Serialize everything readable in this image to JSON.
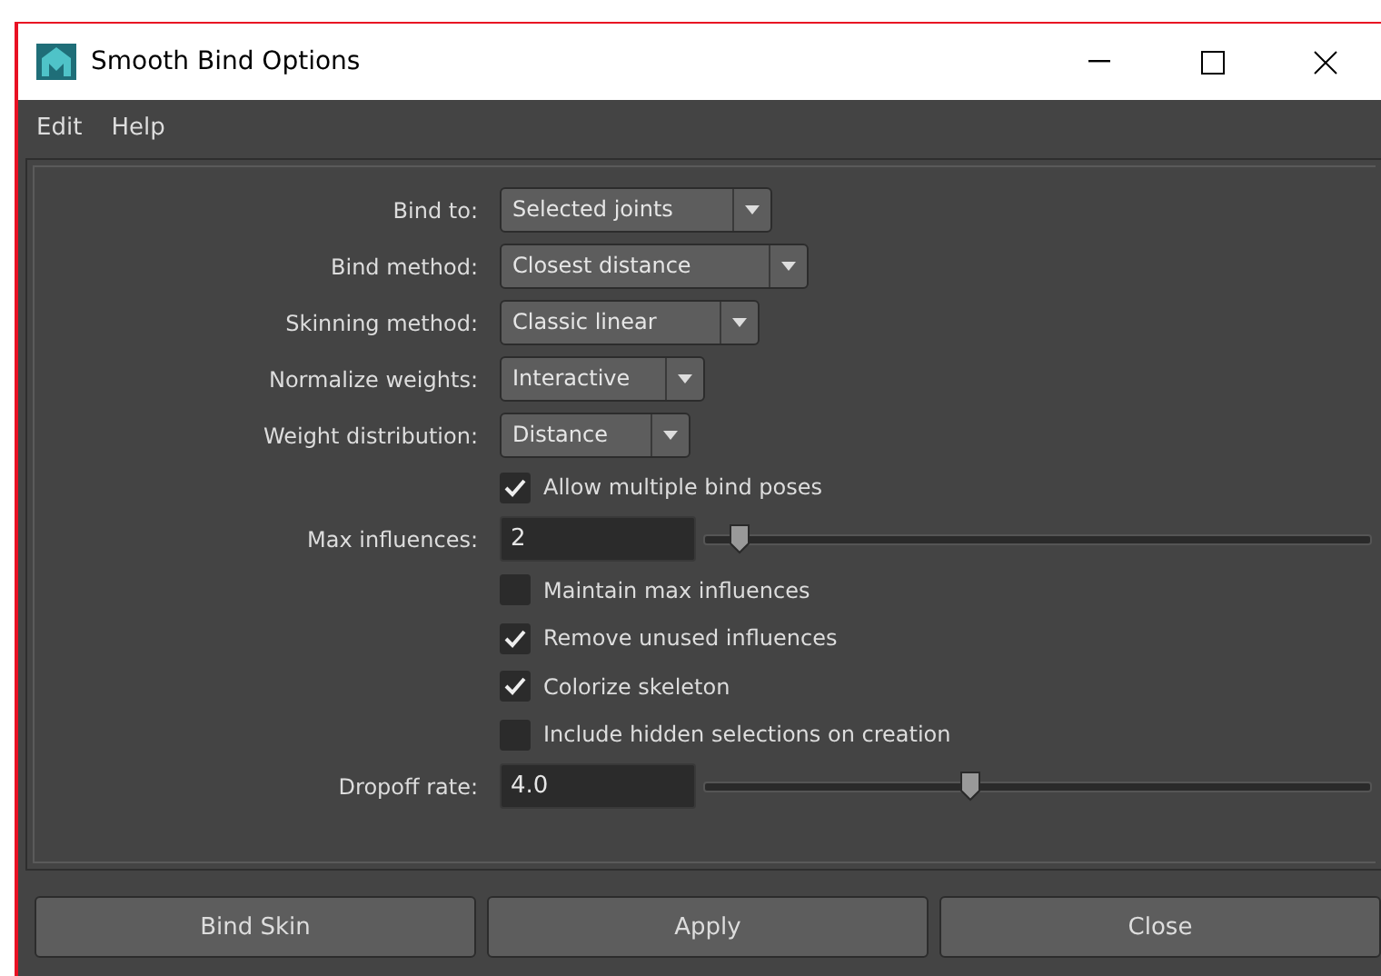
{
  "window": {
    "title": "Smooth Bind Options"
  },
  "menu": [
    "Edit",
    "Help"
  ],
  "rows": [
    {
      "kind": "dropdown",
      "label": "Bind to:",
      "value": "Selected joints"
    },
    {
      "kind": "dropdown",
      "label": "Bind method:",
      "value": "Closest distance"
    },
    {
      "kind": "dropdown",
      "label": "Skinning method:",
      "value": "Classic linear"
    },
    {
      "kind": "dropdown",
      "label": "Normalize weights:",
      "value": "Interactive"
    },
    {
      "kind": "dropdown",
      "label": "Weight distribution:",
      "value": "Distance"
    },
    {
      "kind": "checkbox",
      "label": "Allow multiple bind poses",
      "checked": true
    },
    {
      "kind": "slider",
      "label": "Max influences:",
      "value": "2",
      "level": 0.055
    },
    {
      "kind": "checkbox",
      "label": "Maintain max influences",
      "checked": false
    },
    {
      "kind": "checkbox",
      "label": "Remove unused influences",
      "checked": true
    },
    {
      "kind": "checkbox",
      "label": "Colorize skeleton",
      "checked": true
    },
    {
      "kind": "checkbox",
      "label": "Include hidden selections on creation",
      "checked": false
    },
    {
      "kind": "slider",
      "label": "Dropoff rate:",
      "value": "4.0",
      "level": 0.4
    }
  ],
  "buttons": [
    "Bind Skin",
    "Apply",
    "Close"
  ]
}
